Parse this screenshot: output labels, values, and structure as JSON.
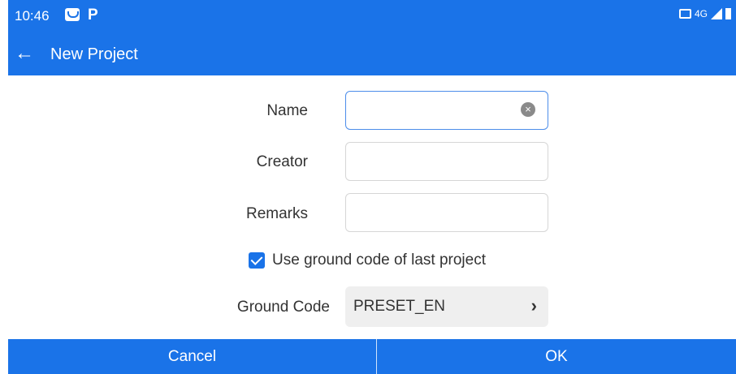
{
  "status_bar": {
    "time": "10:46",
    "app_glyph": "P",
    "network": "4G",
    "icons": [
      "gallery-icon",
      "cast-icon",
      "signal-icon",
      "battery-icon"
    ]
  },
  "app_bar": {
    "back_icon": "arrow-left-icon",
    "title": "New Project"
  },
  "form": {
    "name": {
      "label": "Name",
      "value": ""
    },
    "creator": {
      "label": "Creator",
      "value": ""
    },
    "remarks": {
      "label": "Remarks",
      "value": ""
    },
    "use_last_ground_code": {
      "label": "Use ground code of last project",
      "checked": true
    },
    "ground_code": {
      "label": "Ground Code",
      "value": "PRESET_EN"
    }
  },
  "actions": {
    "cancel": "Cancel",
    "ok": "OK"
  },
  "colors": {
    "primary": "#1a73e8",
    "field_border": "#d6d6d6",
    "select_bg": "#efefef"
  }
}
